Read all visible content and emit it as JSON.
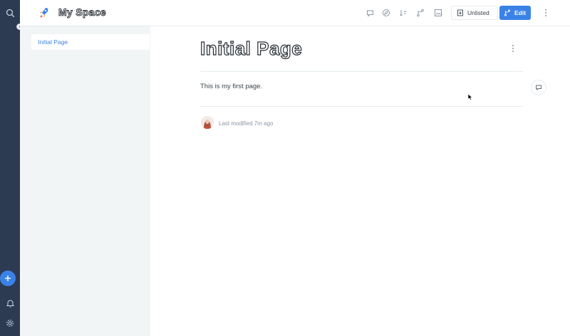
{
  "header": {
    "space_title": "My Space",
    "unlisted_label": "Unlisted",
    "edit_label": "Edit",
    "icons": [
      "comment-icon",
      "compass-icon",
      "sort-icon",
      "branch-icon",
      "image-icon",
      "publish-icon",
      "edit-branch-icon",
      "more-icon"
    ]
  },
  "rail": {
    "icons": [
      "search-icon",
      "plus-icon",
      "bell-icon",
      "gear-icon"
    ]
  },
  "sidebar": {
    "items": [
      {
        "label": "Initial Page",
        "active": true
      }
    ]
  },
  "page": {
    "title": "Initial Page",
    "body": "This is my first page.",
    "last_modified": "Last modified 7m ago"
  },
  "colors": {
    "accent": "#3b82e6",
    "rail": "#2c3a52",
    "sidebar": "#f2f5f6",
    "text": "#242a31",
    "muted": "#8a96a3"
  }
}
